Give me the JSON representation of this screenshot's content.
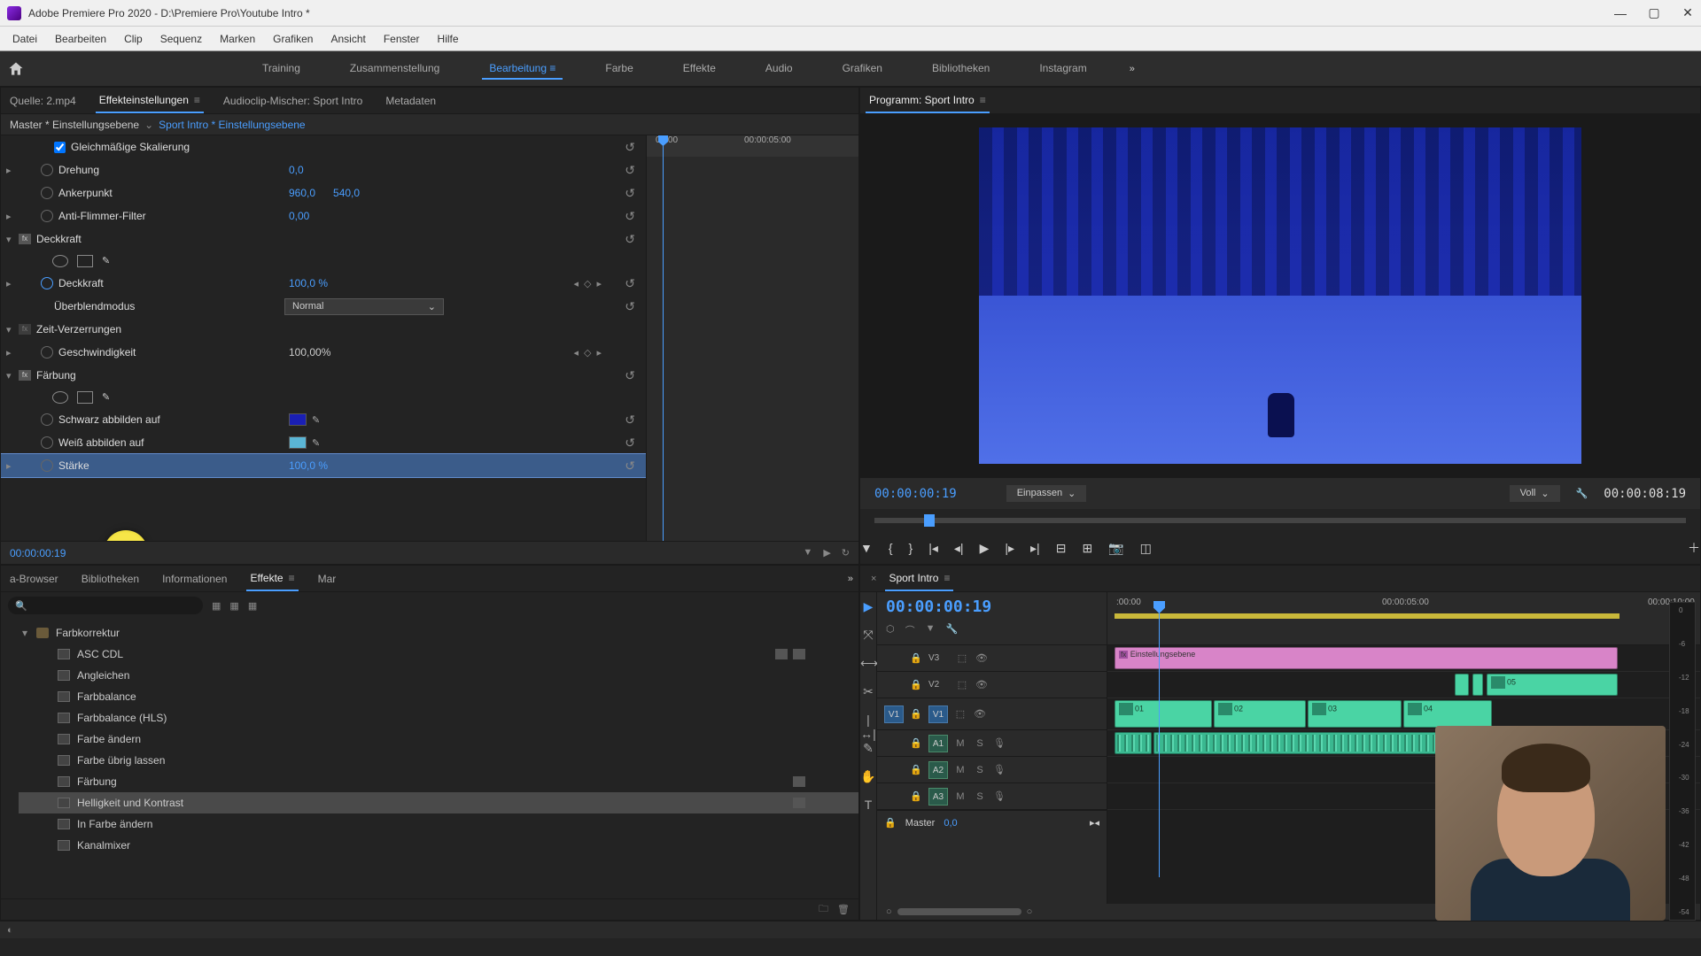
{
  "window": {
    "title": "Adobe Premiere Pro 2020 - D:\\Premiere Pro\\Youtube Intro *"
  },
  "menu": [
    "Datei",
    "Bearbeiten",
    "Clip",
    "Sequenz",
    "Marken",
    "Grafiken",
    "Ansicht",
    "Fenster",
    "Hilfe"
  ],
  "workspaces": {
    "items": [
      "Training",
      "Zusammenstellung",
      "Bearbeitung",
      "Farbe",
      "Effekte",
      "Audio",
      "Grafiken",
      "Bibliotheken",
      "Instagram"
    ],
    "active": "Bearbeitung"
  },
  "source_tabs": {
    "items": [
      "Quelle: 2.mp4",
      "Effekteinstellungen",
      "Audioclip-Mischer: Sport Intro",
      "Metadaten"
    ],
    "active": "Effekteinstellungen"
  },
  "effect_controls": {
    "master": "Master * Einstellungsebene",
    "clip": "Sport Intro * Einstellungsebene",
    "ruler": [
      "00:00",
      "00:00:05:00"
    ],
    "uniform_scale_label": "Gleichmäßige Skalierung",
    "rotation": {
      "label": "Drehung",
      "value": "0,0"
    },
    "anchor": {
      "label": "Ankerpunkt",
      "x": "960,0",
      "y": "540,0"
    },
    "antiflicker": {
      "label": "Anti-Flimmer-Filter",
      "value": "0,00"
    },
    "opacity_group": "Deckkraft",
    "opacity": {
      "label": "Deckkraft",
      "value": "100,0 %"
    },
    "blend": {
      "label": "Überblendmodus",
      "value": "Normal"
    },
    "timeremap_group": "Zeit-Verzerrungen",
    "speed": {
      "label": "Geschwindigkeit",
      "value": "100,00%"
    },
    "tint_group": "Färbung",
    "tint_black": {
      "label": "Schwarz abbilden auf",
      "color": "#1a1fb5"
    },
    "tint_white": {
      "label": "Weiß abbilden auf",
      "color": "#5ab5d5"
    },
    "tint_amount": {
      "label": "Stärke",
      "value": "100,0 %"
    },
    "footer_tc": "00:00:00:19"
  },
  "program": {
    "title": "Programm: Sport Intro",
    "tc_in": "00:00:00:19",
    "fit": "Einpassen",
    "full": "Voll",
    "tc_out": "00:00:08:19"
  },
  "project_tabs": {
    "items": [
      "a-Browser",
      "Bibliotheken",
      "Informationen",
      "Effekte",
      "Mar"
    ],
    "active": "Effekte"
  },
  "effects_tree": {
    "folder": "Farbkorrektur",
    "children": [
      {
        "label": "ASC CDL",
        "badges": 2
      },
      {
        "label": "Angleichen",
        "badges": 0
      },
      {
        "label": "Farbbalance",
        "badges": 0
      },
      {
        "label": "Farbbalance (HLS)",
        "badges": 0
      },
      {
        "label": "Farbe ändern",
        "badges": 0
      },
      {
        "label": "Farbe übrig lassen",
        "badges": 0
      },
      {
        "label": "Färbung",
        "badges": 1
      },
      {
        "label": "Helligkeit und Kontrast",
        "badges": 1,
        "selected": true
      },
      {
        "label": "In Farbe ändern",
        "badges": 0
      },
      {
        "label": "Kanalmixer",
        "badges": 0
      }
    ]
  },
  "timeline": {
    "title": "Sport Intro",
    "tc": "00:00:00:19",
    "ruler": [
      ":00:00",
      "00:00:05:00",
      "00:00:10:00"
    ],
    "tracks_v": [
      "V3",
      "V2",
      "V1"
    ],
    "tracks_a": [
      "A1",
      "A2",
      "A3"
    ],
    "master": "Master",
    "master_val": "0,0",
    "clips": {
      "adj": "Einstellungsebene",
      "v2a": "05",
      "v1": [
        "01",
        "02",
        "03",
        "04"
      ]
    }
  },
  "meter_labels": [
    "0",
    "-6",
    "-12",
    "-18",
    "-24",
    "-30",
    "-36",
    "-42",
    "-48",
    "-54"
  ]
}
